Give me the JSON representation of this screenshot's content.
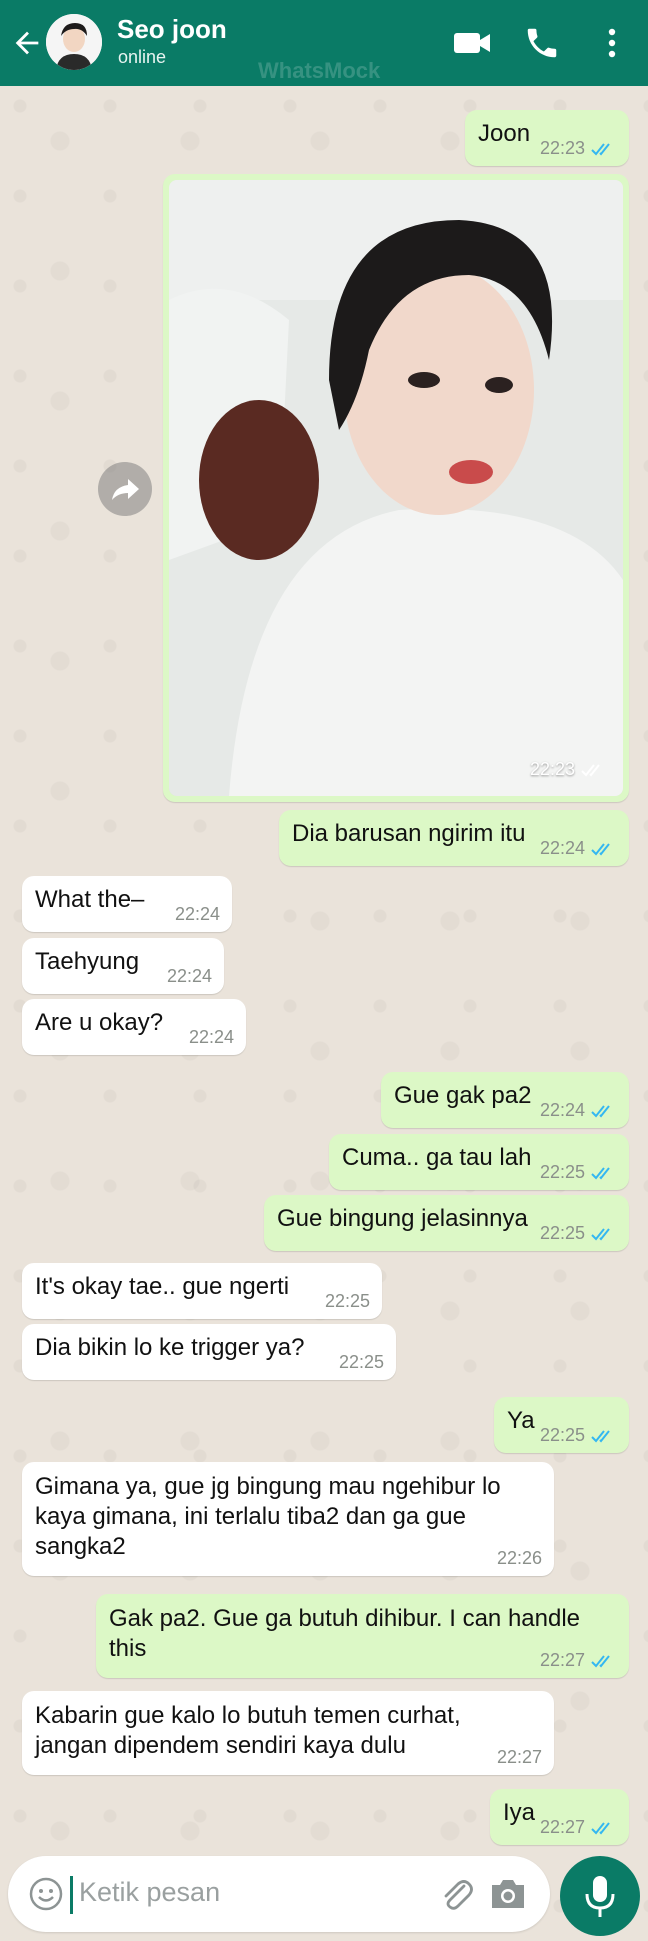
{
  "header": {
    "contact_name": "Seo joon",
    "status": "online",
    "watermark": "WhatsMock"
  },
  "messages": [
    {
      "dir": "out",
      "text": "Joon",
      "time": "22:23"
    },
    {
      "dir": "out",
      "type": "image",
      "time": "22:23"
    },
    {
      "dir": "out",
      "text": "Dia barusan ngirim itu",
      "time": "22:24"
    },
    {
      "dir": "in",
      "text": "What the–",
      "time": "22:24"
    },
    {
      "dir": "in",
      "text": "Taehyung",
      "time": "22:24"
    },
    {
      "dir": "in",
      "text": "Are u okay?",
      "time": "22:24"
    },
    {
      "dir": "out",
      "text": "Gue gak pa2",
      "time": "22:24"
    },
    {
      "dir": "out",
      "text": "Cuma.. ga tau lah",
      "time": "22:25"
    },
    {
      "dir": "out",
      "text": "Gue bingung jelasinnya",
      "time": "22:25"
    },
    {
      "dir": "in",
      "text": "It's okay tae.. gue ngerti",
      "time": "22:25"
    },
    {
      "dir": "in",
      "text": "Dia bikin lo ke trigger ya?",
      "time": "22:25"
    },
    {
      "dir": "out",
      "text": "Ya",
      "time": "22:25"
    },
    {
      "dir": "in",
      "text": "Gimana ya, gue jg bingung mau ngehibur lo kaya gimana, ini terlalu tiba2 dan ga gue sangka2",
      "time": "22:26"
    },
    {
      "dir": "out",
      "text": "Gak pa2. Gue ga butuh dihibur. I can handle this",
      "time": "22:27"
    },
    {
      "dir": "in",
      "text": "Kabarin gue kalo lo butuh temen curhat, jangan dipendem sendiri kaya dulu",
      "time": "22:27"
    },
    {
      "dir": "out",
      "text": "Iya",
      "time": "22:27"
    }
  ],
  "input": {
    "placeholder": "Ketik pesan"
  },
  "colors": {
    "header": "#0A7B66",
    "outgoing_bubble": "#DCF8C6",
    "incoming_bubble": "#FFFFFF",
    "read_ticks": "#34B7F1"
  },
  "icons": [
    "back-arrow-icon",
    "video-call-icon",
    "phone-icon",
    "more-vert-icon",
    "forward-icon",
    "emoji-icon",
    "attach-icon",
    "camera-icon",
    "mic-icon",
    "double-check-icon"
  ]
}
